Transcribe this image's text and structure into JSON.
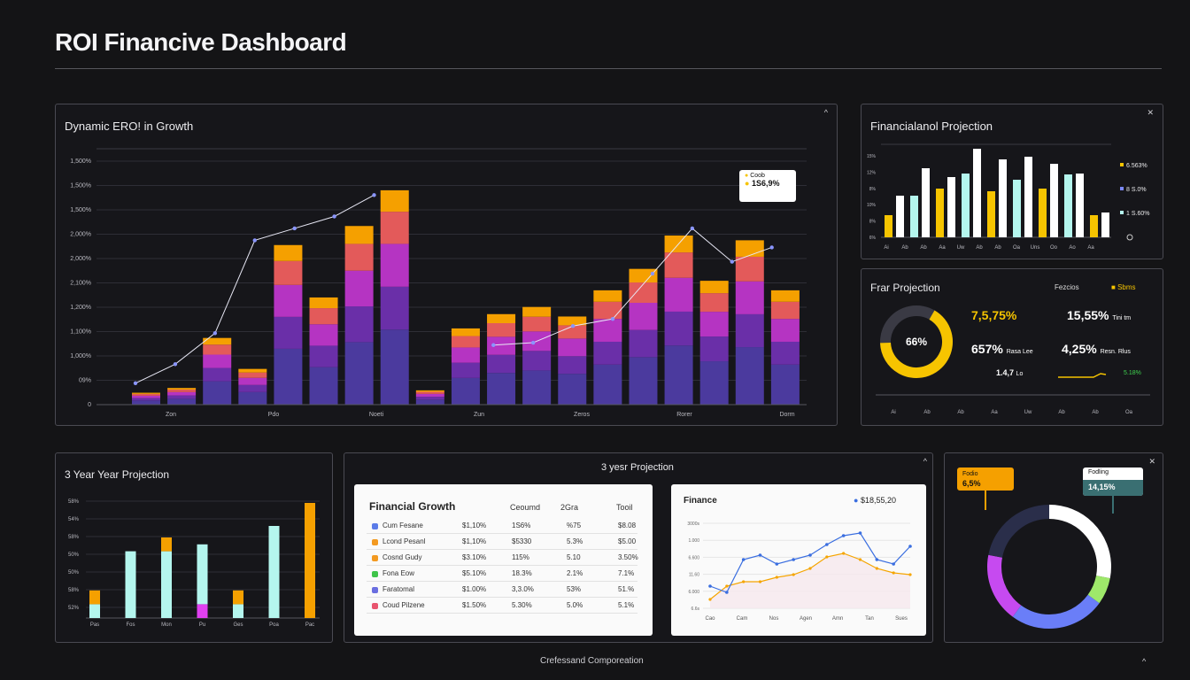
{
  "header": {
    "title": "ROI Financive Dashboard",
    "footer": "Crefessand Comporeation",
    "corner_mark": "^"
  },
  "colors": {
    "background": "#141416",
    "orange": "#f5a000",
    "magenta": "#b534c2",
    "violet": "#4b3a9e",
    "yellow": "#f6c400",
    "mint": "#b4f6ee",
    "white": "#ffffff"
  },
  "icons": {
    "panel_corner": "caret-up-icon",
    "panel_close": "close-icon"
  },
  "chart_data": [
    {
      "type": "bar",
      "title": "Dynamic ERO! in Growth",
      "y_tick_labels": [
        "0",
        "09%",
        "1,000%",
        "1,100%",
        "1,200%",
        "2,100%",
        "2,000%",
        "2,000%",
        "1,500%",
        "1,500%",
        "1,500%"
      ],
      "x_tick_labels": [
        "Zon",
        "Pdo",
        "Noeti",
        "Zun",
        "Zeros",
        "Rorer",
        "Dorm"
      ],
      "ylim": [
        0,
        100
      ],
      "categories": [
        "1",
        "2",
        "3",
        "4",
        "5",
        "6",
        "7",
        "8",
        "9",
        "10",
        "11",
        "12",
        "13",
        "14",
        "15",
        "16",
        "17",
        "18",
        "19",
        "20",
        "21"
      ],
      "series": [
        {
          "values": [
            5,
            7,
            28,
            15,
            67,
            45,
            75,
            90,
            6,
            32,
            38,
            41,
            37,
            48,
            57,
            71,
            52,
            69,
            48
          ]
        },
        {
          "values": [
            null,
            null,
            null,
            null,
            null,
            null,
            null,
            null,
            null,
            null,
            null,
            null,
            null,
            null,
            null,
            null,
            null,
            null,
            null
          ]
        }
      ],
      "stack_tops": [
        5,
        7,
        28,
        15,
        67,
        45,
        75,
        90,
        6,
        32,
        38,
        41,
        37,
        48,
        57,
        71,
        52,
        69,
        48
      ],
      "line": [
        9,
        17,
        30,
        69,
        74,
        79,
        88,
        null,
        null,
        25,
        26,
        33,
        36,
        55,
        74,
        60,
        66
      ],
      "callout": {
        "label": "Coob",
        "value": "1S6,9%"
      }
    },
    {
      "type": "bar",
      "title": "Financialanol Projection",
      "y_tick_labels": [
        "15%",
        "12%",
        "8%",
        "10%",
        "8%",
        "6%"
      ],
      "x_tick_labels": [
        "Ai",
        "Ab",
        "Ab",
        "Aa",
        "Uw",
        "Ab",
        "Ab",
        "Oa",
        "Uns",
        "Oo",
        "Ao",
        "Aa"
      ],
      "ylim": [
        0,
        100
      ],
      "values_pairs": [
        [
          25,
          47
        ],
        [
          47,
          78
        ],
        [
          55,
          68
        ],
        [
          72,
          100
        ],
        [
          52,
          88
        ],
        [
          65,
          91
        ],
        [
          55,
          83
        ],
        [
          71,
          72
        ],
        [
          25,
          28
        ]
      ],
      "legend": [
        {
          "label": "6.563%",
          "color": "#f6c400"
        },
        {
          "label": "8 S.0%",
          "color": "#7b88ff"
        },
        {
          "label": "1 S.60%",
          "color": "#b4f6ee"
        }
      ]
    },
    {
      "type": "pie",
      "title": "Frar Projection",
      "center_label": "66%",
      "fraction": 0.66,
      "stats": [
        {
          "value": "7,5,75%",
          "label": ""
        },
        {
          "value": "15,55%",
          "label": "Tini tm"
        },
        {
          "value": "657%",
          "label": "Rasa Lee"
        },
        {
          "value": "4,25%",
          "label": "Resn. Rlus"
        },
        {
          "value": "1.4,7",
          "label": "Lo"
        },
        {
          "value": "",
          "label": "5.18%"
        }
      ],
      "header_labels": [
        "Fezcios",
        "Sbms"
      ],
      "x_tick_labels": [
        "Ai",
        "Ab",
        "Ab",
        "Aa",
        "Uw",
        "Ab",
        "Ab",
        "Oa"
      ]
    },
    {
      "type": "bar",
      "title": "3 Year Year Projection",
      "y_tick_labels": [
        "58%",
        "54%",
        "58%",
        "50%",
        "50%",
        "58%",
        "52%"
      ],
      "x_tick_labels": [
        "Pas",
        "Fos",
        "Mon",
        "Pu",
        "Ges",
        "Poa",
        "Pac"
      ],
      "ylim": [
        0,
        100
      ],
      "bars": [
        {
          "mint": 12,
          "orange": 12
        },
        {
          "mint": 58,
          "orange": 0
        },
        {
          "mint": 58,
          "orange": 12
        },
        {
          "mint": 52,
          "orange": 0,
          "magenta": 12
        },
        {
          "mint": 12,
          "orange": 12
        },
        {
          "mint": 80,
          "orange": 0
        },
        {
          "mint": 0,
          "orange": 100
        }
      ]
    },
    {
      "type": "table",
      "title": "3 yesr Projection",
      "table_title": "Financial Growth",
      "columns": [
        "Ceoumd",
        "2Gra",
        "Tooil"
      ],
      "rows": [
        {
          "label": "Cum Fesane",
          "c1": "$1,10%",
          "c2": "1S6%",
          "c3": "%75",
          "c4": "$8.08",
          "color": "#5b7be8"
        },
        {
          "label": "Lcond Pesanl",
          "c1": "$1,10%",
          "c2": "$5330",
          "c3": "5.3%",
          "c4": "$5.00",
          "color": "#f39a21"
        },
        {
          "label": "Cosnd Gudy",
          "c1": "$3.10%",
          "c2": "115%",
          "c3": "5.10",
          "c4": "3.50%",
          "color": "#f39a21"
        },
        {
          "label": "Fona Eow",
          "c1": "$5.10%",
          "c2": "18.3%",
          "c3": "2.1%",
          "c4": "7.1%",
          "color": "#3fc44a"
        },
        {
          "label": "Faratomal",
          "c1": "$1.00%",
          "c2": "3,3.0%",
          "c3": "53%",
          "c4": "51.%",
          "color": "#6a6ee0"
        },
        {
          "label": "Coud Pilzene",
          "c1": "$1.50%",
          "c2": "5.30%",
          "c3": "5.0%",
          "c4": "5.1%",
          "color": "#e8546e"
        }
      ]
    },
    {
      "type": "line",
      "title": "Finance",
      "legend_value": "$18,55,20",
      "y_tick_labels": [
        "3000s",
        "1.000",
        "6.600",
        "11.60",
        "6.000",
        "6.6s"
      ],
      "x_tick_labels": [
        "Cao",
        "Cam",
        "Nos",
        "Agen",
        "Amn",
        "Tan",
        "Sues"
      ],
      "ylim": [
        0,
        100
      ],
      "series": [
        {
          "values": [
            25,
            18,
            55,
            60,
            50,
            55,
            60,
            72,
            82,
            85,
            55,
            50,
            70
          ]
        },
        {
          "values": [
            10,
            25,
            30,
            30,
            35,
            38,
            45,
            58,
            62,
            55,
            45,
            40,
            38
          ]
        }
      ]
    },
    {
      "type": "pie",
      "title": "",
      "bubbles": [
        {
          "label": "Fodio",
          "value": "6,5%"
        },
        {
          "label": "Fodling",
          "value": "14,15%"
        }
      ],
      "slices": [
        {
          "value": 28,
          "color": "#ffffff"
        },
        {
          "value": 7,
          "color": "#9ee86a"
        },
        {
          "value": 25,
          "color": "#6a7ef8"
        },
        {
          "value": 18,
          "color": "#c64af0"
        },
        {
          "value": 22,
          "color": "#2a2e4a"
        }
      ]
    }
  ]
}
